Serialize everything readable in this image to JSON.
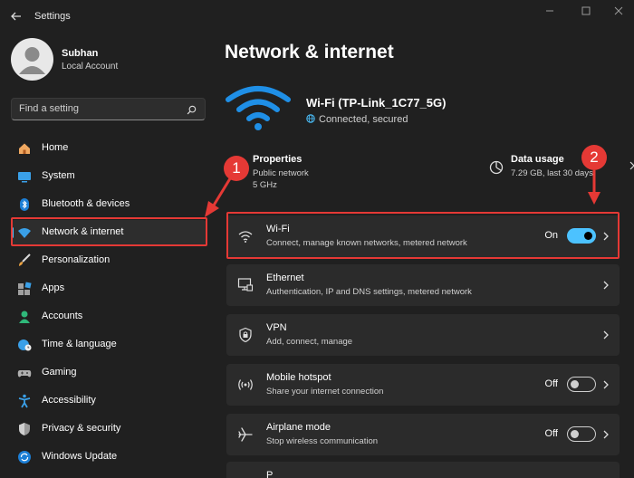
{
  "window": {
    "title": "Settings"
  },
  "user": {
    "name": "Subhan",
    "account_type": "Local Account"
  },
  "search": {
    "placeholder": "Find a setting"
  },
  "sidebar": {
    "items": [
      {
        "label": "Home",
        "icon": "home-icon"
      },
      {
        "label": "System",
        "icon": "system-icon"
      },
      {
        "label": "Bluetooth & devices",
        "icon": "bluetooth-icon"
      },
      {
        "label": "Network & internet",
        "icon": "wifi-icon",
        "active": true
      },
      {
        "label": "Personalization",
        "icon": "brush-icon"
      },
      {
        "label": "Apps",
        "icon": "apps-icon"
      },
      {
        "label": "Accounts",
        "icon": "accounts-icon"
      },
      {
        "label": "Time & language",
        "icon": "globe-clock-icon"
      },
      {
        "label": "Gaming",
        "icon": "gamepad-icon"
      },
      {
        "label": "Accessibility",
        "icon": "accessibility-icon"
      },
      {
        "label": "Privacy & security",
        "icon": "shield-icon"
      },
      {
        "label": "Windows Update",
        "icon": "update-icon"
      }
    ]
  },
  "main": {
    "title": "Network & internet",
    "network": {
      "name": "Wi-Fi (TP-Link_1C77_5G)",
      "status": "Connected, secured"
    },
    "properties": {
      "title": "Properties",
      "line1": "Public network",
      "line2": "5 GHz"
    },
    "data_usage": {
      "title": "Data usage",
      "detail": "7.29 GB, last 30 days"
    },
    "cards": [
      {
        "title": "Wi-Fi",
        "subtitle": "Connect, manage known networks, metered network",
        "state": "On",
        "toggle": true,
        "icon": "wifi-icon"
      },
      {
        "title": "Ethernet",
        "subtitle": "Authentication, IP and DNS settings, metered network",
        "icon": "ethernet-icon"
      },
      {
        "title": "VPN",
        "subtitle": "Add, connect, manage",
        "icon": "vpn-shield-icon"
      },
      {
        "title": "Mobile hotspot",
        "subtitle": "Share your internet connection",
        "state": "Off",
        "toggle": false,
        "icon": "hotspot-icon"
      },
      {
        "title": "Airplane mode",
        "subtitle": "Stop wireless communication",
        "state": "Off",
        "toggle": false,
        "icon": "airplane-icon"
      }
    ],
    "partial_card_title": "P"
  },
  "annotations": {
    "badge1": "1",
    "badge2": "2"
  },
  "colors": {
    "accent": "#4cc2ff",
    "highlight": "#e53935",
    "background": "#202020",
    "card": "#2b2b2b"
  }
}
